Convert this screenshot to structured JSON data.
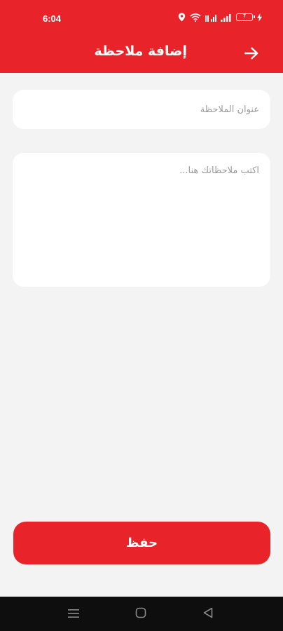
{
  "status_bar": {
    "time": "6:04",
    "battery_level": "7"
  },
  "app_bar": {
    "title": "إضافة ملاحظة",
    "back_icon": "arrow-right-icon"
  },
  "form": {
    "title_placeholder": "عنوان الملاحظة",
    "title_value": "",
    "body_placeholder": "اكتب ملاحظاتك هنا...",
    "body_value": ""
  },
  "actions": {
    "save_label": "حفظ"
  },
  "nav_bar": {
    "icons": [
      "menu-icon",
      "home-icon",
      "back-triangle-icon"
    ]
  },
  "colors": {
    "primary": "#e8242a",
    "background": "#f3f3f3",
    "surface": "#ffffff",
    "placeholder": "#9a9a9a",
    "nav_bar": "#0e0e0e"
  }
}
